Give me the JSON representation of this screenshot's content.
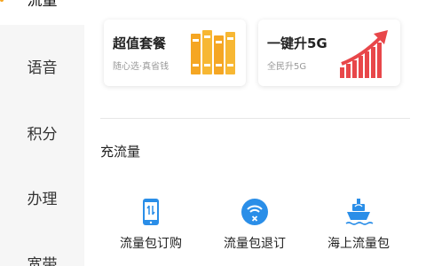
{
  "sidebar": {
    "items": [
      {
        "label": "流量",
        "active": true
      },
      {
        "label": "语音"
      },
      {
        "label": "积分"
      },
      {
        "label": "办理"
      },
      {
        "label": "宽带"
      }
    ]
  },
  "cards": [
    {
      "title": "超值套餐",
      "subtitle": "随心选·真省钱",
      "icon": "books-icon"
    },
    {
      "title": "一键升5G",
      "subtitle": "全民升5G",
      "icon": "growth-chart-icon"
    }
  ],
  "section": {
    "title": "充流量"
  },
  "services": [
    {
      "label": "流量包订购",
      "icon": "phone-data-icon"
    },
    {
      "label": "流量包退订",
      "icon": "wifi-cancel-icon"
    },
    {
      "label": "海上流量包",
      "icon": "ship-icon"
    }
  ],
  "colors": {
    "accent": "#f5a623",
    "primary_icon": "#2a8ee8",
    "chart_red": "#e8474a"
  }
}
